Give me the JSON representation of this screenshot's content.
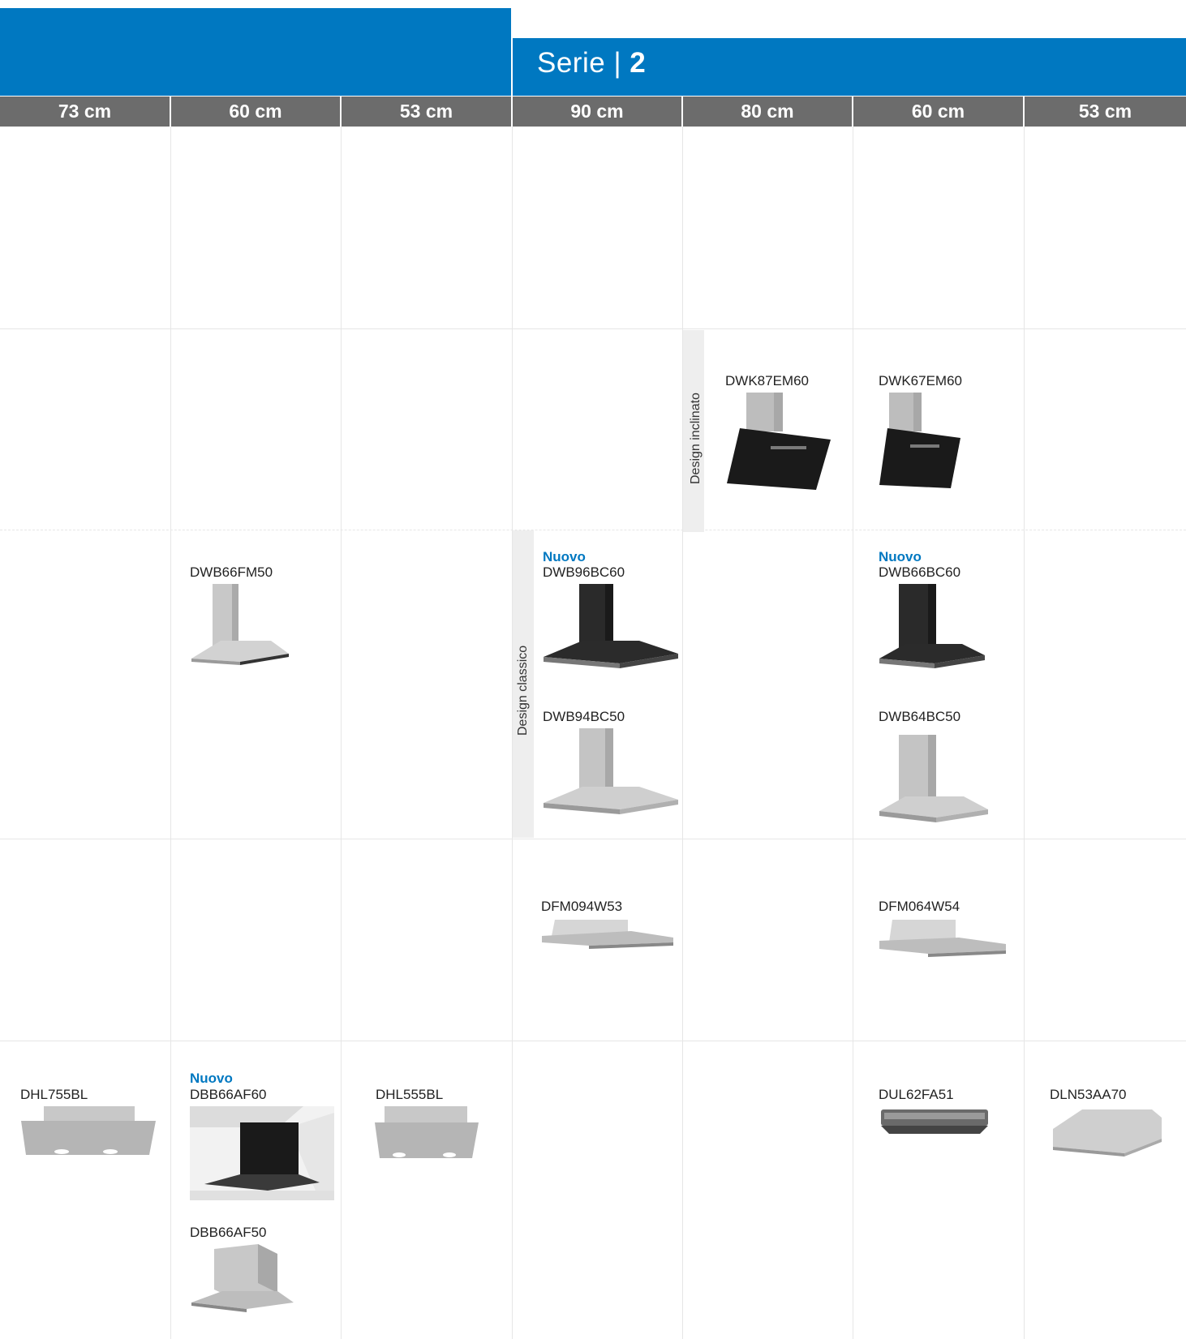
{
  "header": {
    "series_word": "Serie",
    "series_sep": "|",
    "series_number": "2"
  },
  "columns": [
    "73 cm",
    "60 cm",
    "53 cm",
    "90 cm",
    "80 cm",
    "60 cm",
    "53 cm"
  ],
  "side_labels": {
    "inclinato": "Design inclinato",
    "classico": "Design classico"
  },
  "new_badge": "Nuovo",
  "products": {
    "dwk87em60": "DWK87EM60",
    "dwk67em60": "DWK67EM60",
    "dwb66fm50": "DWB66FM50",
    "dwb96bc60": "DWB96BC60",
    "dwb66bc60": "DWB66BC60",
    "dwb94bc50": "DWB94BC50",
    "dwb64bc50": "DWB64BC50",
    "dfm094w53": "DFM094W53",
    "dfm064w54": "DFM064W54",
    "dhl755bl": "DHL755BL",
    "dbb66af60": "DBB66AF60",
    "dhl555bl": "DHL555BL",
    "dul62fa51": "DUL62FA51",
    "dln53aa70": "DLN53AA70",
    "dbb66af50": "DBB66AF50"
  },
  "colors": {
    "brand_blue": "#0078c1",
    "header_grey": "#6c6c6c",
    "band_grey": "#eeeeee"
  }
}
